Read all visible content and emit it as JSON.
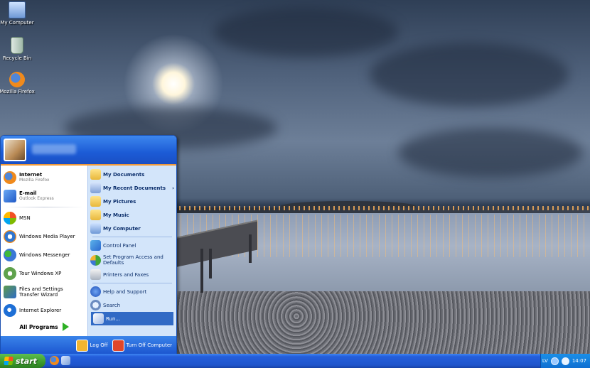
{
  "desktop": {
    "icons": [
      {
        "label": "My Computer",
        "icon": "my-computer-icon"
      },
      {
        "label": "Recycle Bin",
        "icon": "recycle-bin-icon"
      },
      {
        "label": "Mozilla Firefox",
        "icon": "firefox-icon"
      }
    ]
  },
  "start_menu": {
    "left_pinned": [
      {
        "label": "Internet",
        "sub": "Mozilla Firefox",
        "icon": "firefox-icon"
      },
      {
        "label": "E-mail",
        "sub": "Outlook Express",
        "icon": "outlook-express-icon"
      }
    ],
    "left_recent": [
      {
        "label": "MSN",
        "icon": "msn-icon"
      },
      {
        "label": "Windows Media Player",
        "icon": "media-player-icon"
      },
      {
        "label": "Windows Messenger",
        "icon": "messenger-icon"
      },
      {
        "label": "Tour Windows XP",
        "icon": "tour-icon"
      },
      {
        "label": "Files and Settings Transfer Wizard",
        "icon": "transfer-wizard-icon"
      },
      {
        "label": "Internet Explorer",
        "icon": "internet-explorer-icon"
      }
    ],
    "all_programs": "All Programs",
    "right": [
      {
        "label": "My Documents",
        "icon": "folder-icon",
        "bold": true
      },
      {
        "label": "My Recent Documents",
        "icon": "recent-docs-icon",
        "bold": true,
        "chevron": "›"
      },
      {
        "label": "My Pictures",
        "icon": "pictures-icon",
        "bold": true
      },
      {
        "label": "My Music",
        "icon": "music-icon",
        "bold": true
      },
      {
        "label": "My Computer",
        "icon": "computer-icon",
        "bold": true
      },
      {
        "label": "Control Panel",
        "icon": "control-panel-icon"
      },
      {
        "label": "Set Program Access and Defaults",
        "icon": "program-access-icon"
      },
      {
        "label": "Printers and Faxes",
        "icon": "printer-icon"
      },
      {
        "label": "Help and Support",
        "icon": "help-icon"
      },
      {
        "label": "Search",
        "icon": "search-icon"
      },
      {
        "label": "Run...",
        "icon": "run-icon",
        "selected": true
      }
    ],
    "footer": {
      "log_off": "Log Off",
      "turn_off": "Turn Off Computer"
    }
  },
  "taskbar": {
    "start_label": "start",
    "language": "LV",
    "clock": "14:07"
  }
}
